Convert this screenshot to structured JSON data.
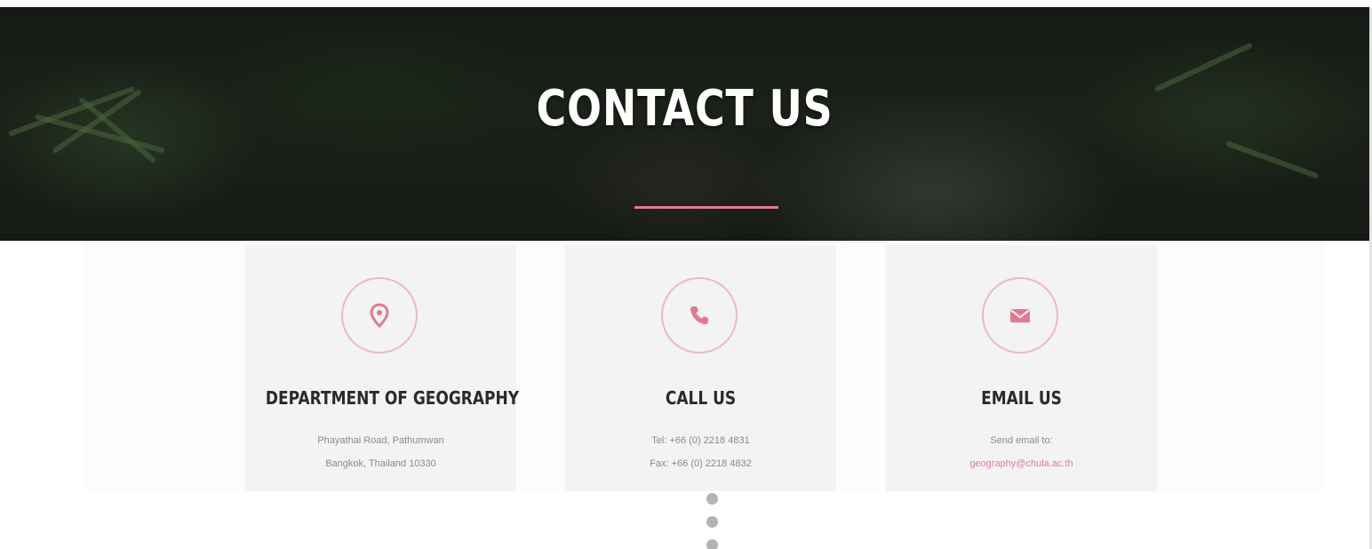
{
  "hero": {
    "title": "CONTACT US"
  },
  "colors": {
    "accent": "#e07a92",
    "card_bg": "#f3f3f3",
    "title_text": "#2a2a2a",
    "body_text": "#8a8a8a"
  },
  "cards": [
    {
      "icon": "map-pin-icon",
      "title": "DEPARTMENT OF GEOGRAPHY",
      "line1": "Phayathai Road, Pathumwan",
      "line2": "Bangkok, Thailand 10330"
    },
    {
      "icon": "phone-icon",
      "title": "CALL US",
      "line1": "Tel: +66 (0) 2218 4831",
      "line2": "Fax: +66 (0) 2218 4832"
    },
    {
      "icon": "envelope-icon",
      "title": "EMAIL US",
      "line1": "Send email to:",
      "line2": "geography@chula.ac.th"
    }
  ]
}
